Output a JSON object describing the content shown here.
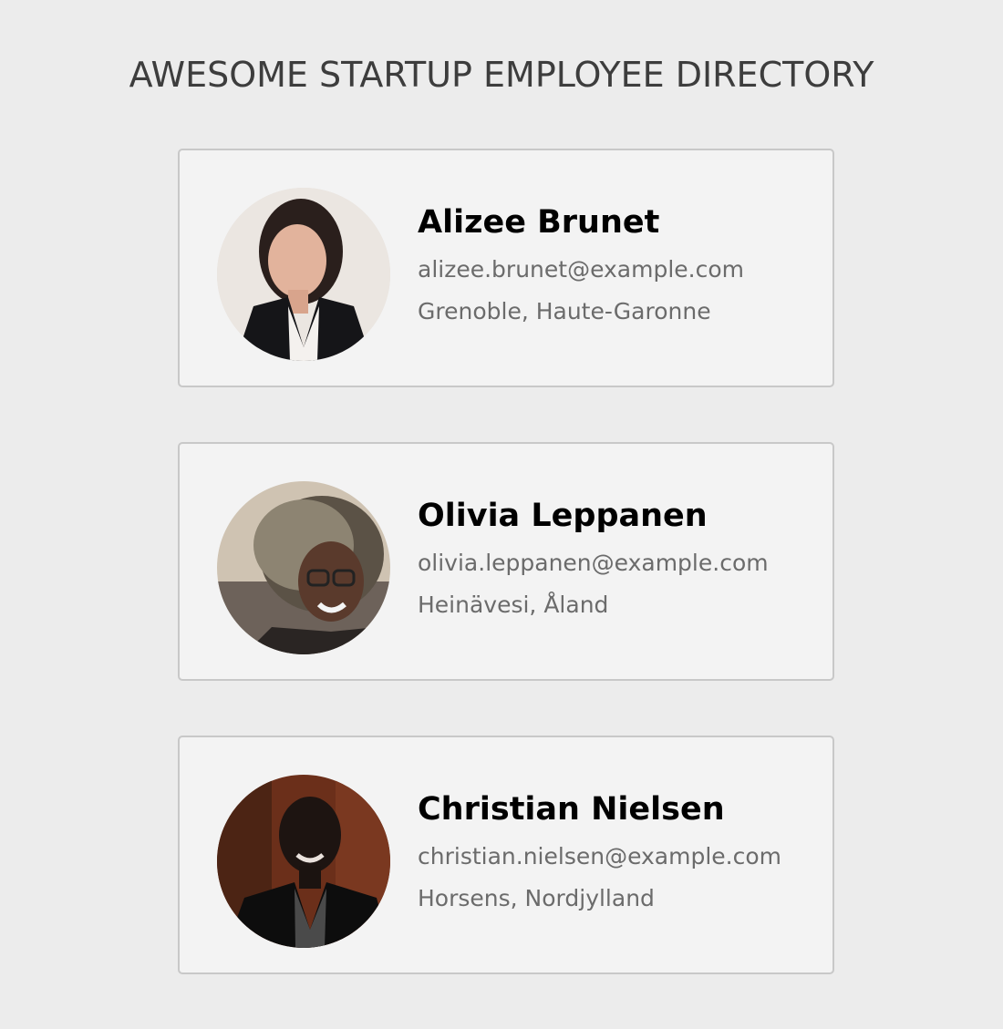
{
  "header": {
    "title": "AWESOME STARTUP EMPLOYEE DIRECTORY"
  },
  "employees": [
    {
      "name": "Alizee Brunet",
      "email": "alizee.brunet@example.com",
      "location": "Grenoble, Haute-Garonne",
      "avatar_icon": "avatar-photo"
    },
    {
      "name": "Olivia Leppanen",
      "email": "olivia.leppanen@example.com",
      "location": "Heinävesi, Åland",
      "avatar_icon": "avatar-photo"
    },
    {
      "name": "Christian Nielsen",
      "email": "christian.nielsen@example.com",
      "location": "Horsens, Nordjylland",
      "avatar_icon": "avatar-photo"
    }
  ],
  "colors": {
    "background": "#ececec",
    "card_background": "#f3f3f3",
    "card_border": "#c8c8c8",
    "title_text": "#3d3d3d",
    "secondary_text": "#6b6b6b"
  }
}
